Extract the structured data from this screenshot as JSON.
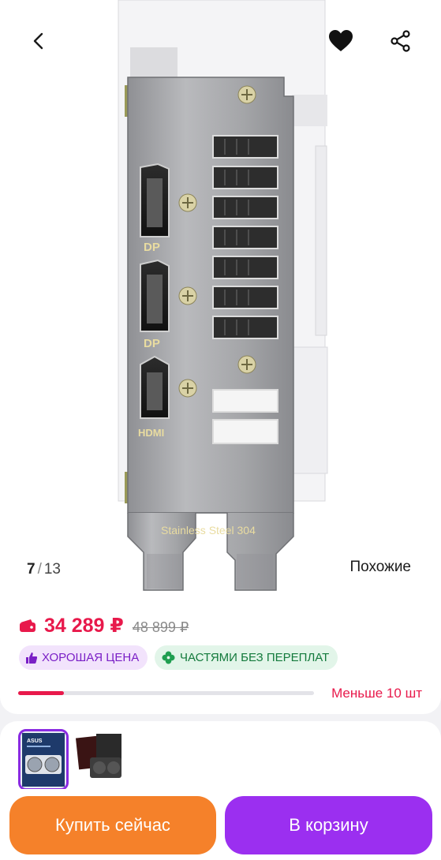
{
  "gallery": {
    "current_index": "7",
    "separator": "/",
    "total": "13",
    "similar_label": "Похожие",
    "port_labels": [
      "DP",
      "DP",
      "HDMI"
    ],
    "engraving": "Stainless Steel 304",
    "thumb_brand": "ASUS"
  },
  "price": {
    "current": "34 289 ₽",
    "old": "48 899 ₽",
    "accent_color": "#e8194b"
  },
  "badges": {
    "good_price": "ХОРОШАЯ ЦЕНА",
    "installments": "ЧАСТЯМИ БЕЗ ПЕРЕПЛАТ"
  },
  "stock": {
    "label": "Меньше 10 шт"
  },
  "actions": {
    "buy_now": "Купить сейчас",
    "add_to_cart": "В корзину",
    "buy_color": "#f5812a",
    "cart_color": "#9b2ff0"
  },
  "icons": {
    "back": "chevron-left-icon",
    "favorite": "heart-icon",
    "share": "share-icon",
    "wallet": "wallet-icon",
    "thumbs_up": "thumbs-up-icon",
    "clover": "clover-icon"
  }
}
